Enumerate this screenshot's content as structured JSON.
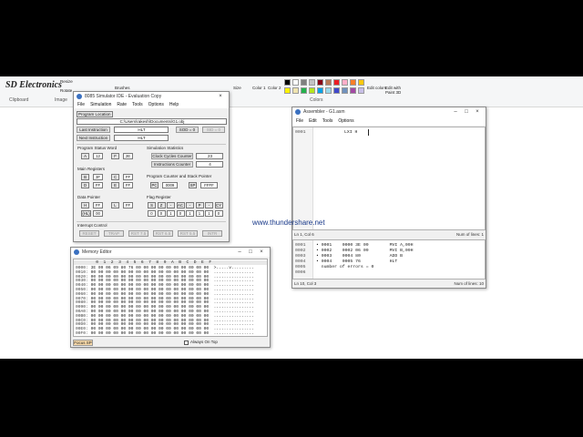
{
  "brand": "SD Electronics",
  "ribbon": {
    "groups": [
      "Clipboard",
      "Image",
      "Colors"
    ],
    "buttons": [
      "Resize",
      "Rotate",
      "Brushes",
      "Size",
      "Color 1",
      "Color 2",
      "Edit colors",
      "Edit with Paint 3D"
    ],
    "colors": [
      "#000000",
      "#ffffff",
      "#7f7f7f",
      "#c3c3c3",
      "#880015",
      "#b97a57",
      "#ed1c24",
      "#ffaec9",
      "#ff7f27",
      "#ffc90e",
      "#fff200",
      "#efe4b0",
      "#22b14c",
      "#b5e61d",
      "#00a2e8",
      "#99d9ea",
      "#3f48cc",
      "#7092be",
      "#a349a4",
      "#c8bfe7"
    ]
  },
  "sim": {
    "title": "8085 Simulator IDE - Evaluation Copy",
    "menu": [
      "File",
      "Simulation",
      "Rate",
      "Tools",
      "Options",
      "Help"
    ],
    "program_location_label": "Program Location",
    "program_location": "C:\\Users\\rakesh\\Documents\\G1.obj",
    "last_instruction_label": "Last Instruction",
    "last_instruction": "HLT",
    "next_instruction_label": "Next Instruction",
    "next_instruction": "HLT",
    "sod_label": "SOD = 0",
    "sid_label": "SID = 0",
    "psw_label": "Program Status Word",
    "psw": {
      "a_label": "A",
      "a": "12",
      "f_label": "F",
      "f": "2E"
    },
    "sim_stats_label": "Simulation Statistics",
    "clock_cycles_label": "Clock Cycles Counter",
    "clock_cycles": "23",
    "instr_counter_label": "Instructions Counter",
    "instr_counter": "4",
    "main_regs_label": "Main Registers",
    "regs": [
      {
        "l1": "B",
        "v1": "3F",
        "l2": "C",
        "v2": "FF"
      },
      {
        "l1": "D",
        "v1": "FF",
        "l2": "E",
        "v2": "FF"
      }
    ],
    "pc_sp_label": "Program Counter and Stack Pointer",
    "pc_label": "PC",
    "pc": "0009",
    "sp_label": "SP",
    "sp": "FFFF",
    "data_pointer_label": "Data Pointer",
    "h_label": "H",
    "h": "FF",
    "l_label": "L",
    "l": "FF",
    "m_label": "(HL)",
    "m": "00",
    "flag_label": "Flag Register",
    "flag_names": [
      "S",
      "Z",
      "-",
      "AC",
      "-",
      "P",
      "-",
      "CY"
    ],
    "flag_values": [
      "0",
      "0",
      "1",
      "0",
      "1",
      "1",
      "1",
      "0"
    ],
    "interrupt_label": "Interrupt Control",
    "interrupts": [
      "RESET",
      "TRAP",
      "RST 7.5",
      "RST 6.5",
      "RST 5.5",
      "INTR"
    ]
  },
  "memory": {
    "title": "Memory Editor",
    "header": "   0  1  2  3  4  5  6  7  8  9  A  B  C  D  E  F",
    "rows": [
      {
        "addr": "0000:",
        "bytes": "3E 09 06 09 80 76 00 00 00 00 00 00 00 00 00 00",
        "ascii": ">.....v........."
      },
      {
        "addr": "0010:",
        "bytes": "00 00 00 00 00 00 00 00 00 00 00 00 00 00 00 00",
        "ascii": "................"
      },
      {
        "addr": "0020:",
        "bytes": "00 00 00 00 00 00 00 00 00 00 00 00 00 00 00 00",
        "ascii": "................"
      },
      {
        "addr": "0030:",
        "bytes": "00 00 00 00 00 00 00 00 00 00 00 00 00 00 00 00",
        "ascii": "................"
      },
      {
        "addr": "0040:",
        "bytes": "00 00 00 00 00 00 00 00 00 00 00 00 00 00 00 00",
        "ascii": "................"
      },
      {
        "addr": "0050:",
        "bytes": "00 00 00 00 00 00 00 00 00 00 00 00 00 00 00 00",
        "ascii": "................"
      },
      {
        "addr": "0060:",
        "bytes": "00 00 00 00 00 00 00 00 00 00 00 00 00 00 00 00",
        "ascii": "................"
      },
      {
        "addr": "0070:",
        "bytes": "00 00 00 00 00 00 00 00 00 00 00 00 00 00 00 00",
        "ascii": "................"
      },
      {
        "addr": "0080:",
        "bytes": "00 00 00 00 00 00 00 00 00 00 00 00 00 00 00 00",
        "ascii": "................"
      },
      {
        "addr": "0090:",
        "bytes": "00 00 00 00 00 00 00 00 00 00 00 00 00 00 00 00",
        "ascii": "................"
      },
      {
        "addr": "00A0:",
        "bytes": "00 00 00 00 00 00 00 00 00 00 00 00 00 00 00 00",
        "ascii": "................"
      },
      {
        "addr": "00B0:",
        "bytes": "00 00 00 00 00 00 00 00 00 00 00 00 00 00 00 00",
        "ascii": "................"
      },
      {
        "addr": "00C0:",
        "bytes": "00 00 00 00 00 00 00 00 00 00 00 00 00 00 00 00",
        "ascii": "................"
      },
      {
        "addr": "00D0:",
        "bytes": "00 00 00 00 00 00 00 00 00 00 00 00 00 00 00 00",
        "ascii": "................"
      },
      {
        "addr": "00E0:",
        "bytes": "00 00 00 00 00 00 00 00 00 00 00 00 00 00 00 00",
        "ascii": "................"
      },
      {
        "addr": "00F0:",
        "bytes": "00 00 00 00 00 00 00 00 00 00 00 00 00 00 00 00",
        "ascii": "................"
      }
    ],
    "focus_sp": "Focus SP",
    "always_on_top": "Always On Top"
  },
  "assembler": {
    "title": "Assembler - G1.asm",
    "menu": [
      "File",
      "Edit",
      "Tools",
      "Options"
    ],
    "source_lines": [
      {
        "num": "0001",
        "text": "LXI H"
      }
    ],
    "status_left": "Ln 1, Col 6",
    "status_right": "Num of lines: 1",
    "listing": [
      {
        "num": "0001",
        "text": "• 0001    0000 3E 09        MVI A,09H"
      },
      {
        "num": "0002",
        "text": "• 0002    0002 06 09        MVI B,09H"
      },
      {
        "num": "0003",
        "text": "• 0003    0004 80           ADD B"
      },
      {
        "num": "0004",
        "text": "• 0004    0005 76           HLT"
      },
      {
        "num": "0005",
        "text": "  number of errors = 0"
      },
      {
        "num": "0006",
        "text": ""
      }
    ],
    "listing_status_left": "Ln 10, Col 3",
    "listing_status_right": "Num of lines: 10"
  },
  "watermark": "www.thundershare.net"
}
